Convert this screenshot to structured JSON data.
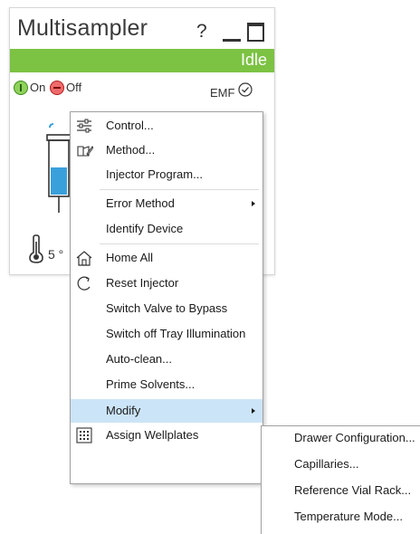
{
  "module": {
    "title": "Multisampler",
    "help_label": "?",
    "status": "Idle",
    "on_label": "On",
    "off_label": "Off",
    "emf_label": "EMF",
    "temperature": "5 °",
    "status_color": "#7cc243"
  },
  "context_menu": {
    "items": [
      {
        "label": "Control...",
        "icon": "sliders-icon"
      },
      {
        "label": "Method...",
        "icon": "method-icon"
      },
      {
        "label": "Injector Program..."
      },
      {
        "label": "Error Method",
        "has_submenu": true
      },
      {
        "label": "Identify Device"
      },
      {
        "label": "Home All",
        "icon": "home-icon"
      },
      {
        "label": "Reset Injector",
        "icon": "reset-icon"
      },
      {
        "label": "Switch Valve to Bypass"
      },
      {
        "label": "Switch off Tray Illumination"
      },
      {
        "label": "Auto-clean..."
      },
      {
        "label": "Prime Solvents..."
      },
      {
        "label": "Modify",
        "has_submenu": true,
        "highlighted": true
      },
      {
        "label": "Assign Wellplates",
        "icon": "wellplate-icon"
      }
    ],
    "highlight_color": "#cce4f7"
  },
  "modify_submenu": {
    "items": [
      {
        "label": "Drawer Configuration..."
      },
      {
        "label": "Capillaries..."
      },
      {
        "label": "Reference Vial Rack..."
      },
      {
        "label": "Temperature Mode..."
      }
    ]
  }
}
